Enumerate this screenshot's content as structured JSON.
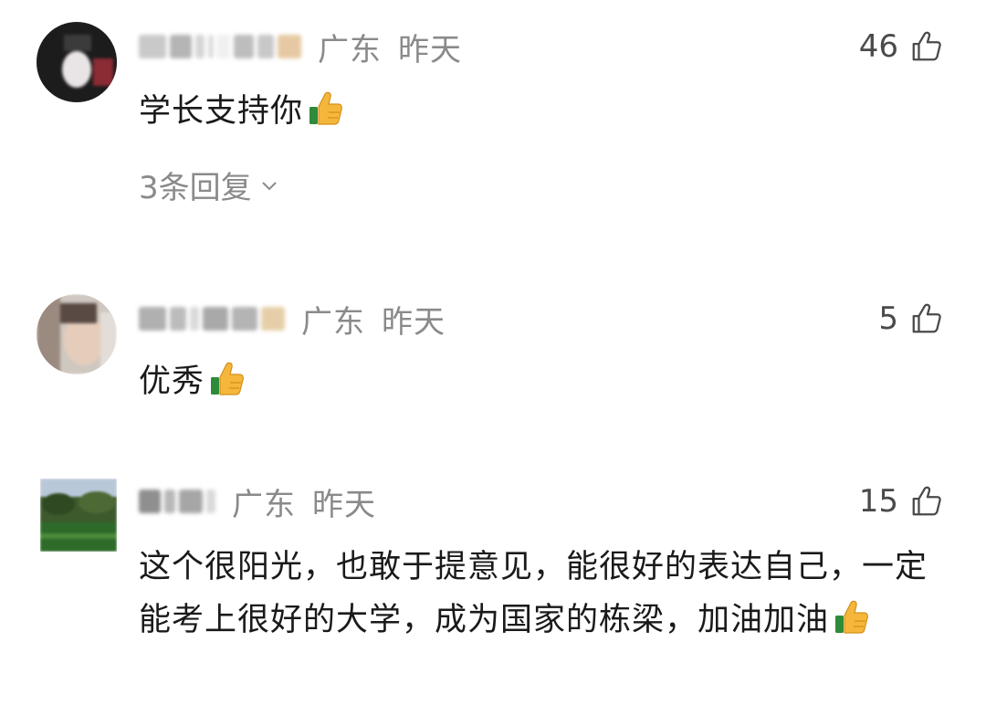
{
  "comments": [
    {
      "location": "广东",
      "time": "昨天",
      "likes": "46",
      "text": "学长支持你",
      "replies": "3条回复"
    },
    {
      "location": "广东",
      "time": "昨天",
      "likes": "5",
      "text": "优秀"
    },
    {
      "location": "广东",
      "time": "昨天",
      "likes": "15",
      "text": "这个很阳光，也敢于提意见，能很好的表达自己，一定能考上很好的大学，成为国家的栋梁，加油加油"
    }
  ],
  "icons": {
    "like": "thumbs-up-outline-icon",
    "emoji": "thumbs-up-emoji-icon",
    "expand": "chevron-down-icon"
  },
  "colors": {
    "meta_gray": "#8a8a8a",
    "text": "#1a1a1a"
  }
}
